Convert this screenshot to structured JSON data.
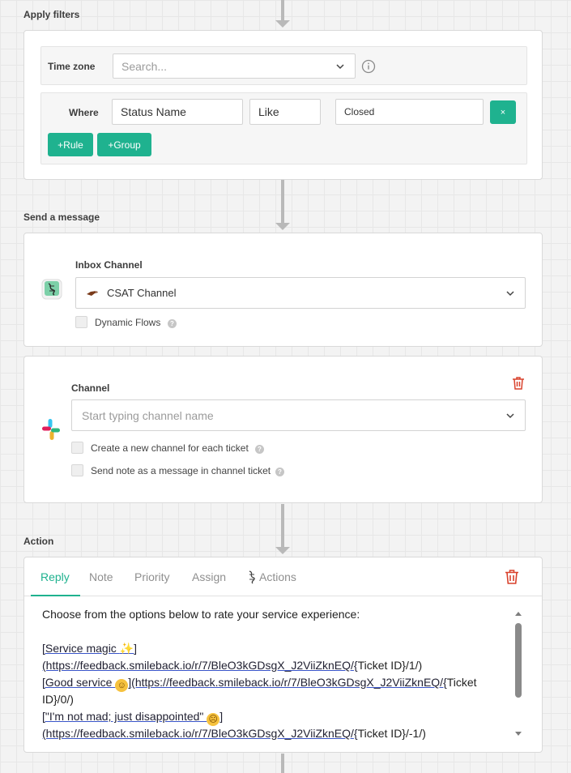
{
  "filters": {
    "section_title": "Apply filters",
    "time_zone_label": "Time zone",
    "time_zone_placeholder": "Search...",
    "where_label": "Where",
    "field": "Status Name",
    "operator": "Like",
    "value": "Closed",
    "remove_label": "×",
    "add_rule_label": "+Rule",
    "add_group_label": "+Group"
  },
  "send_message": {
    "section_title": "Send a message",
    "inbox_channel_label": "Inbox Channel",
    "inbox_channel_value": "CSAT Channel",
    "dynamic_flows_label": "Dynamic Flows",
    "help_glyph": "?"
  },
  "slack": {
    "channel_label": "Channel",
    "channel_placeholder": "Start typing channel name",
    "create_channel_label": "Create a new channel for each ticket",
    "send_note_label": "Send note as a message in channel ticket"
  },
  "action": {
    "section_title": "Action",
    "tabs": [
      "Reply",
      "Note",
      "Priority",
      "Assign",
      "Actions"
    ],
    "active_tab": "Reply",
    "message": {
      "intro": "Choose from the options below to rate your service experience:",
      "l1a": "[Service magic ",
      "l1b": "]",
      "l2a": "(https://feedback.smileback.io/r/7/BleO3kGDsgX_J2ViiZknEQ/",
      "l2b": "{",
      "l2c": "Ticket ID}/1/)",
      "l3a": "[Good service ",
      "l3b": "](https://feedback.smileback.io/r/7/BleO3kGDsgX_J2ViiZknEQ/",
      "l3c": "{",
      "l3d": "Ticket",
      "l4": "ID}/0/)",
      "l5a": "[\"I'm not mad; just disappointed\" ",
      "l5b": "]",
      "l6a": "(https://feedback.smileback.io/r/7/BleO3kGDsgX_J2ViiZknEQ/",
      "l6b": "{",
      "l6c": "Ticket ID}/-1/)"
    }
  },
  "colors": {
    "accent": "#1fb28f",
    "danger": "#d9412b",
    "link_underline": "#3a55c8"
  }
}
